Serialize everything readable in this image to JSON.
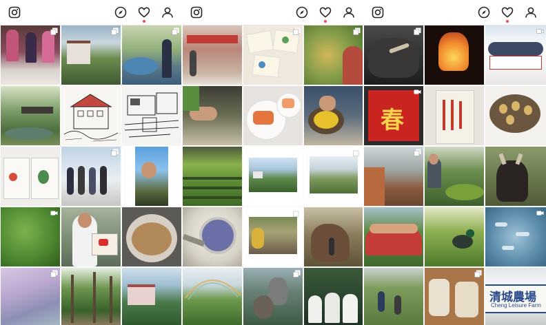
{
  "panels": [
    {
      "icons": [
        "instagram-logo-icon",
        "compass-icon",
        "heart-icon",
        "profile-icon"
      ],
      "notification_dot": true
    },
    {
      "icons": [
        "instagram-logo-icon",
        "compass-icon",
        "heart-icon",
        "profile-icon"
      ],
      "notification_dot": true
    },
    {
      "icons": [
        "instagram-logo-icon",
        "compass-icon",
        "heart-icon",
        "profile-icon"
      ],
      "notification_dot": true
    }
  ],
  "posts": {
    "chun_character": "春",
    "farm_sign_zh": "清城農場",
    "farm_sign_en": "Cheng Leisure Farm"
  },
  "colors": {
    "accent_dot": "#ed4956",
    "divider": "#e6e6e6",
    "icon": "#262626"
  }
}
